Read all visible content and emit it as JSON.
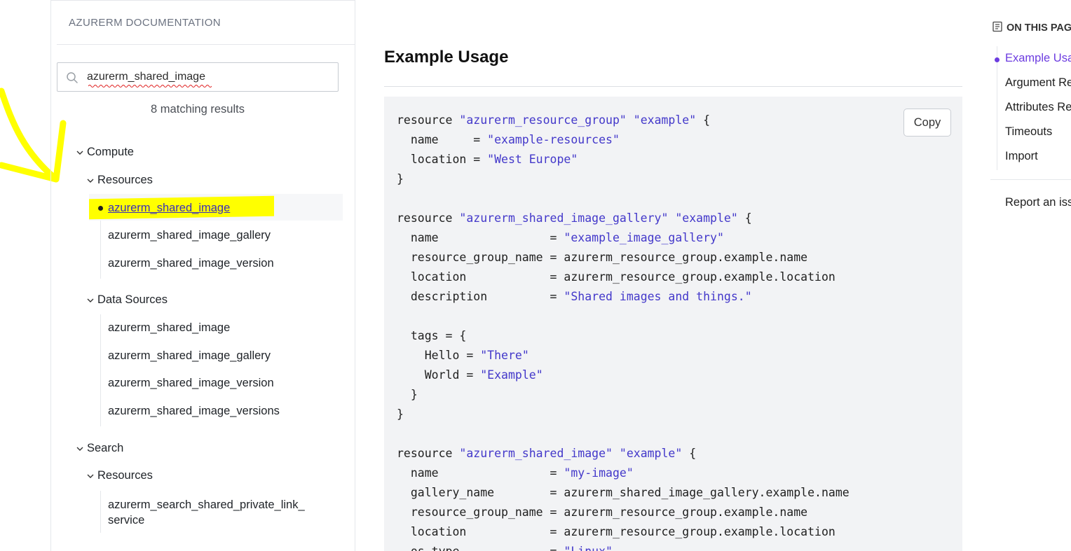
{
  "sidebar": {
    "title": "AZURERM DOCUMENTATION",
    "search": {
      "value": "azurerm_shared_image"
    },
    "match_count": "8 matching results",
    "tree": {
      "compute": "Compute",
      "compute_resources": "Resources",
      "compute_resources_items": [
        "azurerm_shared_image",
        "azurerm_shared_image_gallery",
        "azurerm_shared_image_version"
      ],
      "compute_data_sources": "Data Sources",
      "compute_data_sources_items": [
        "azurerm_shared_image",
        "azurerm_shared_image_gallery",
        "azurerm_shared_image_version",
        "azurerm_shared_image_versions"
      ],
      "search": "Search",
      "search_resources": "Resources",
      "search_resources_items": [
        "azurerm_search_shared_private_link_",
        "service"
      ]
    }
  },
  "main": {
    "title": "Example Usage",
    "copy_label": "Copy",
    "code_lines": [
      [
        [
          "t",
          "resource "
        ],
        [
          "s",
          "\"azurerm_resource_group\""
        ],
        [
          "t",
          " "
        ],
        [
          "s",
          "\"example\""
        ],
        [
          "t",
          " {"
        ]
      ],
      [
        [
          "t",
          "  name     = "
        ],
        [
          "s",
          "\"example-resources\""
        ]
      ],
      [
        [
          "t",
          "  location = "
        ],
        [
          "s",
          "\"West Europe\""
        ]
      ],
      [
        [
          "t",
          "}"
        ]
      ],
      [
        [
          "t",
          ""
        ]
      ],
      [
        [
          "t",
          "resource "
        ],
        [
          "s",
          "\"azurerm_shared_image_gallery\""
        ],
        [
          "t",
          " "
        ],
        [
          "s",
          "\"example\""
        ],
        [
          "t",
          " {"
        ]
      ],
      [
        [
          "t",
          "  name                = "
        ],
        [
          "s",
          "\"example_image_gallery\""
        ]
      ],
      [
        [
          "t",
          "  resource_group_name = azurerm_resource_group.example.name"
        ]
      ],
      [
        [
          "t",
          "  location            = azurerm_resource_group.example.location"
        ]
      ],
      [
        [
          "t",
          "  description         = "
        ],
        [
          "s",
          "\"Shared images and things.\""
        ]
      ],
      [
        [
          "t",
          ""
        ]
      ],
      [
        [
          "t",
          "  tags = {"
        ]
      ],
      [
        [
          "t",
          "    Hello = "
        ],
        [
          "s",
          "\"There\""
        ]
      ],
      [
        [
          "t",
          "    World = "
        ],
        [
          "s",
          "\"Example\""
        ]
      ],
      [
        [
          "t",
          "  }"
        ]
      ],
      [
        [
          "t",
          "}"
        ]
      ],
      [
        [
          "t",
          ""
        ]
      ],
      [
        [
          "t",
          "resource "
        ],
        [
          "s",
          "\"azurerm_shared_image\""
        ],
        [
          "t",
          " "
        ],
        [
          "s",
          "\"example\""
        ],
        [
          "t",
          " {"
        ]
      ],
      [
        [
          "t",
          "  name                = "
        ],
        [
          "s",
          "\"my-image\""
        ]
      ],
      [
        [
          "t",
          "  gallery_name        = azurerm_shared_image_gallery.example.name"
        ]
      ],
      [
        [
          "t",
          "  resource_group_name = azurerm_resource_group.example.name"
        ]
      ],
      [
        [
          "t",
          "  location            = azurerm_resource_group.example.location"
        ]
      ],
      [
        [
          "t",
          "  os_type             = "
        ],
        [
          "s",
          "\"Linux\""
        ]
      ]
    ]
  },
  "on_this_page": {
    "header": "ON THIS PAGE",
    "items": [
      "Example Usage",
      "Argument Reference",
      "Attributes Reference",
      "Timeouts",
      "Import"
    ],
    "report_link": "Report an issue"
  },
  "colors": {
    "highlight": "#ffff00",
    "accent": "#6c3ce0",
    "code_string": "#4338ca"
  }
}
